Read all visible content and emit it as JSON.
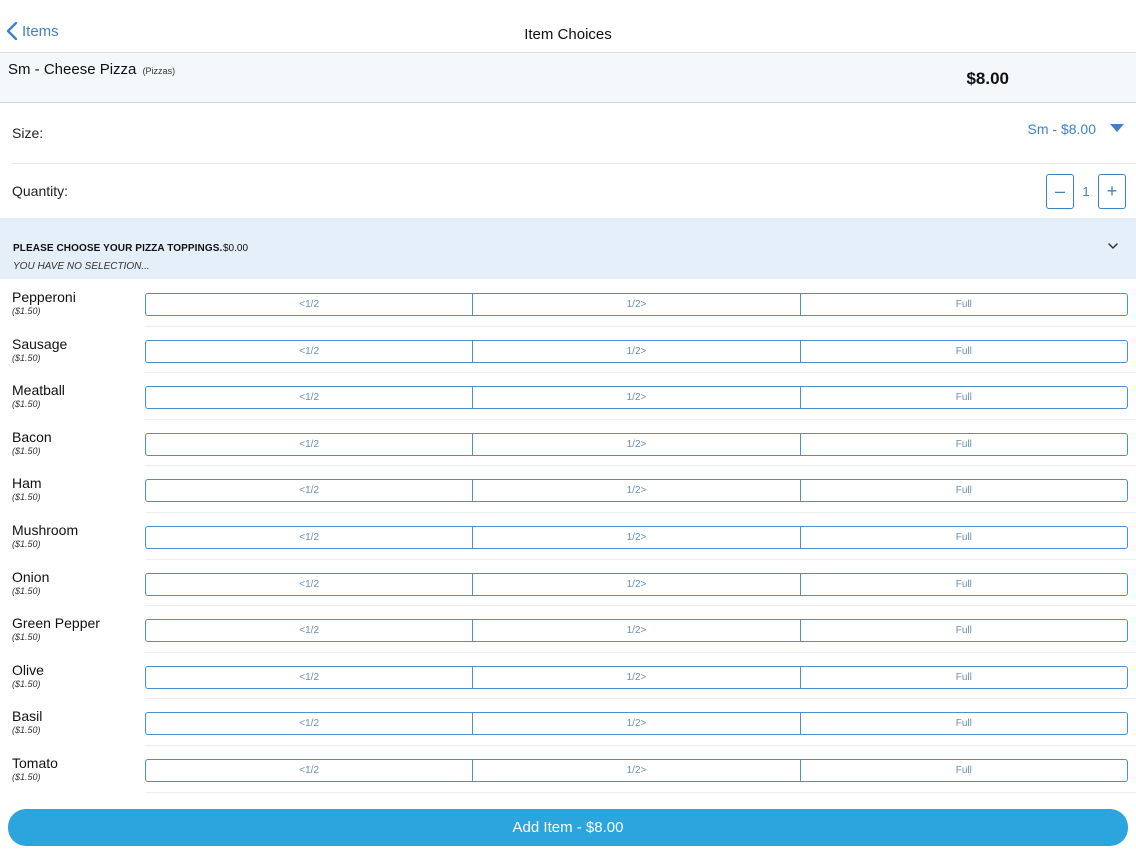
{
  "nav": {
    "back_label": "Items",
    "title": "Item Choices"
  },
  "item": {
    "name": "Sm - Cheese Pizza",
    "category": "(Pizzas)",
    "price": "$8.00"
  },
  "size": {
    "label": "Size:",
    "selected": "Sm - $8.00"
  },
  "quantity": {
    "label": "Quantity:",
    "value": "1",
    "minus": "–",
    "plus": "+"
  },
  "toppings_section": {
    "title": "PLEASE CHOOSE YOUR PIZZA TOPPINGS.",
    "price": "$0.00",
    "subtitle": "YOU HAVE NO SELECTION..."
  },
  "portion_options": [
    "<1/2",
    "1/2>",
    "Full"
  ],
  "toppings": [
    {
      "name": "Pepperoni",
      "price": "($1.50)"
    },
    {
      "name": "Sausage",
      "price": "($1.50)"
    },
    {
      "name": "Meatball",
      "price": "($1.50)"
    },
    {
      "name": "Bacon",
      "price": "($1.50)"
    },
    {
      "name": "Ham",
      "price": "($1.50)"
    },
    {
      "name": "Mushroom",
      "price": "($1.50)"
    },
    {
      "name": "Onion",
      "price": "($1.50)"
    },
    {
      "name": "Green Pepper",
      "price": "($1.50)"
    },
    {
      "name": "Olive",
      "price": "($1.50)"
    },
    {
      "name": "Basil",
      "price": "($1.50)"
    },
    {
      "name": "Tomato",
      "price": "($1.50)"
    }
  ],
  "add_button": "Add Item - $8.00",
  "colors": {
    "accent": "#3f82c4",
    "add_button": "#2ca4dd",
    "section_bg": "#e4eff9",
    "header_bg": "#f4f8fb"
  }
}
